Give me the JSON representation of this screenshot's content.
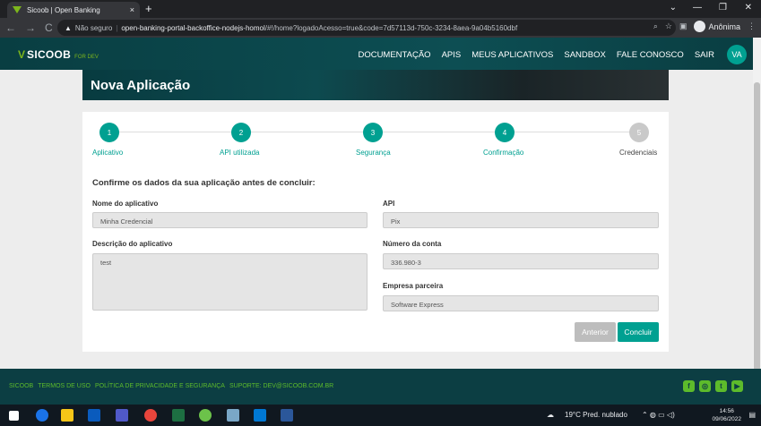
{
  "browser": {
    "tab_title": "Sicoob | Open Banking",
    "tab_close": "×",
    "new_tab": "+",
    "back": "←",
    "forward": "→",
    "reload": "C",
    "security": "Não seguro",
    "url_host": "open-banking-portal-backoffice-nodejs-homol",
    "url_path": "/#!/home?logadoAcesso=true&code=7d57113d-750c-3234-8aea-9a04b5160dbf",
    "profile": "Anônima"
  },
  "header": {
    "brand": "SICOOB",
    "brand_sub": "FOR DEV",
    "nav": [
      "DOCUMENTAÇÃO",
      "APIS",
      "MEUS APLICATIVOS",
      "SANDBOX",
      "FALE CONOSCO",
      "SAIR"
    ],
    "avatar": "VA"
  },
  "page": {
    "title": "Nova Aplicação"
  },
  "stepper": {
    "steps": [
      {
        "num": "1",
        "label": "Aplicativo"
      },
      {
        "num": "2",
        "label": "API utilizada"
      },
      {
        "num": "3",
        "label": "Segurança"
      },
      {
        "num": "4",
        "label": "Confirmação"
      },
      {
        "num": "5",
        "label": "Credenciais"
      }
    ]
  },
  "form": {
    "heading": "Confirme os dados da sua aplicação antes de concluir:",
    "app_name_label": "Nome do aplicativo",
    "app_name_value": "Minha Credencial",
    "desc_label": "Descrição do aplicativo",
    "desc_value": "test",
    "api_label": "API",
    "api_value": "Pix",
    "account_label": "Número da conta",
    "account_value": "336.980-3",
    "partner_label": "Empresa parceira",
    "partner_value": "Software Express",
    "prev_button": "Anterior",
    "finish_button": "Concluir"
  },
  "footer": {
    "links": [
      "SICOOB",
      "TERMOS DE USO",
      "POLÍTICA DE PRIVACIDADE E SEGURANÇA",
      "SUPORTE: DEV@SICOOB.COM.BR"
    ]
  },
  "taskbar": {
    "weather": "19°C  Pred. nublado",
    "time": "14:56",
    "date": "09/06/2022"
  },
  "colors": {
    "primary": "#00a091",
    "header": "#0c3e43",
    "accent": "#5dbb2b"
  }
}
